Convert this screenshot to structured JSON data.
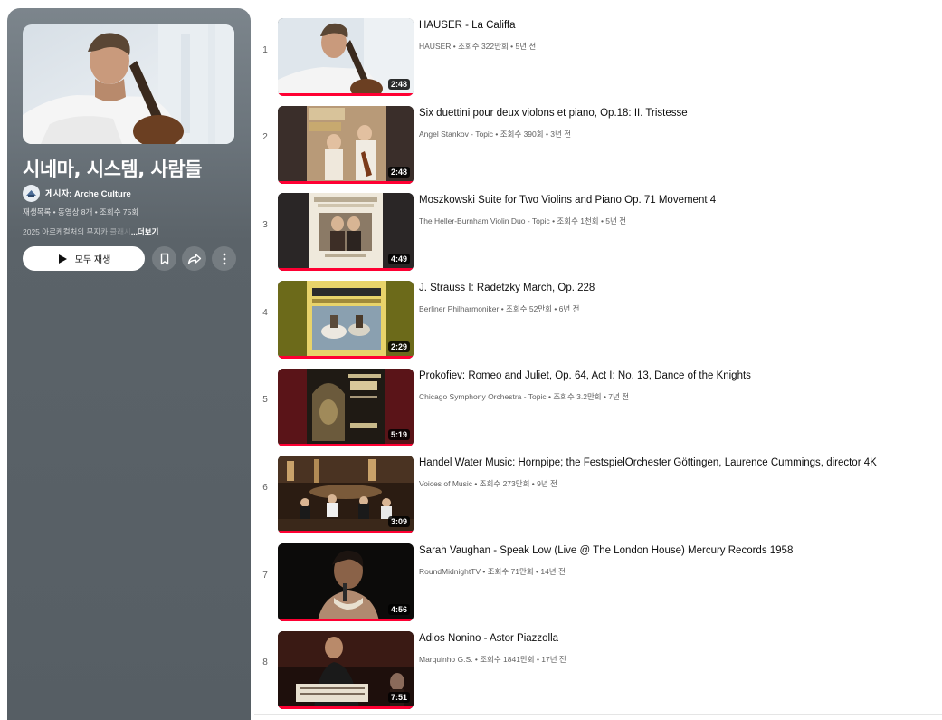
{
  "playlist": {
    "title": "시네마, 시스템, 사람들",
    "owner": "게시자: Arche Culture",
    "meta": "재생목록 • 동영상 8개 • 조회수 75회",
    "description": "2025 아르케컬처의 무지카 클래시",
    "more_label": "...더보기",
    "play_all_label": "모두 재생",
    "save_icon": "bookmark-icon",
    "share_icon": "share-icon",
    "more_icon": "more-vert-icon"
  },
  "videos": [
    {
      "index": "1",
      "title": "HAUSER - La Califfa",
      "meta": "HAUSER • 조회수 322만회 • 5년 전",
      "duration": "2:48",
      "watched": 1.0
    },
    {
      "index": "2",
      "title": "Six duettini pour deux violons et piano, Op.18: II. Tristesse",
      "meta": "Angel Stankov - Topic • 조회수 390회 • 3년 전",
      "duration": "2:48",
      "watched": 1.0
    },
    {
      "index": "3",
      "title": "Moszkowski Suite for Two Violins and Piano Op. 71 Movement 4",
      "meta": "The Heller-Burnham Violin Duo - Topic • 조회수 1천회 • 5년 전",
      "duration": "4:49",
      "watched": 1.0
    },
    {
      "index": "4",
      "title": "J. Strauss I: Radetzky March, Op. 228",
      "meta": "Berliner Philharmoniker • 조회수 52만회 • 6년 전",
      "duration": "2:29",
      "watched": 1.0
    },
    {
      "index": "5",
      "title": "Prokofiev: Romeo and Juliet, Op. 64, Act I: No. 13, Dance of the Knights",
      "meta": "Chicago Symphony Orchestra - Topic • 조회수 3.2만회 • 7년 전",
      "duration": "5:19",
      "watched": 1.0
    },
    {
      "index": "6",
      "title": "Handel Water Music: Hornpipe; the FestspielOrchester Göttingen, Laurence Cummings, director 4K",
      "meta": "Voices of Music • 조회수 273만회 • 9년 전",
      "duration": "3:09",
      "watched": 1.0
    },
    {
      "index": "7",
      "title": "Sarah Vaughan - Speak Low (Live @ The London House) Mercury Records 1958",
      "meta": "RoundMidnightTV • 조회수 71만회 • 14년 전",
      "duration": "4:56",
      "watched": 1.0
    },
    {
      "index": "8",
      "title": "Adios Nonino - Astor Piazzolla",
      "meta": "Marquinho G.S. • 조회수 1841만회 • 17년 전",
      "duration": "7:51",
      "watched": 1.0
    }
  ],
  "colors": {
    "progress": "#ff0033",
    "panel": "#5b6369",
    "accent_text": "#0f0f0f"
  }
}
